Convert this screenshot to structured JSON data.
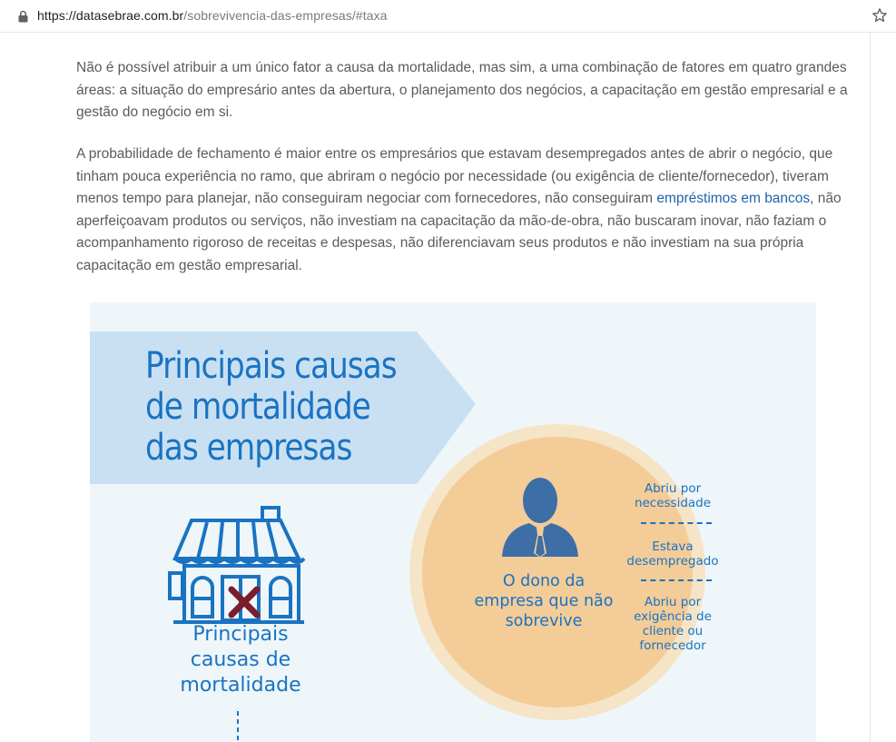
{
  "browser": {
    "url_host": "https://datasebrae.com.br",
    "url_path": "/sobrevivencia-das-empresas/#taxa",
    "lock_icon": "lock-icon",
    "bookmark_icon": "star-icon"
  },
  "article": {
    "paragraph1": "Não é possível atribuir a um único fator a causa da mortalidade, mas sim, a uma combinação de fatores em quatro grandes áreas: a situação do empresário antes da abertura, o planejamento dos negócios, a capacitação em gestão empresarial e a gestão do negócio em si.",
    "paragraph2_before_link": "A probabilidade de fechamento é maior entre os empresários que estavam desempregados antes de abrir o negócio, que tinham pouca experiência no ramo, que abriram o negócio por necessidade (ou exigência de cliente/fornecedor), tiveram menos tempo para planejar, não conseguiram negociar com fornecedores, não conseguiram ",
    "paragraph2_link": "empréstimos em bancos",
    "paragraph2_after_link": ", não aperfeiçoavam produtos ou serviços, não investiam na capacitação da mão-de-obra, não buscaram inovar, não faziam o acompanhamento rigoroso de receitas e despesas, não diferenciavam seus produtos e não investiam na sua própria capacitação em gestão empresarial.",
    "link_color": "#1f64ad"
  },
  "infographic": {
    "title_line1": "Principais causas",
    "title_line2": "de mortalidade",
    "title_line3": "das empresas",
    "shop_label_line1": "Principais",
    "shop_label_line2": "causas de",
    "shop_label_line3": "mortalidade",
    "owner_label_line1": "O dono da",
    "owner_label_line2": "empresa que não",
    "owner_label_line3": "sobrevive",
    "causes": [
      {
        "line1": "Abriu por",
        "line2": "necessidade",
        "line3": ""
      },
      {
        "line1": "Estava",
        "line2": "desempregado",
        "line3": ""
      },
      {
        "line1": "Abriu por",
        "line2": "exigência de",
        "line3": "cliente ou",
        "line4": "fornecedor"
      }
    ],
    "colors": {
      "background": "#eef6f9",
      "banner": "#c9e0f2",
      "accent_blue": "#1a73c2",
      "circle_outer": "#f6e4c6",
      "circle_inner": "#f3cc98",
      "person": "#3e6ea6",
      "cross": "#7a1e2e"
    }
  }
}
